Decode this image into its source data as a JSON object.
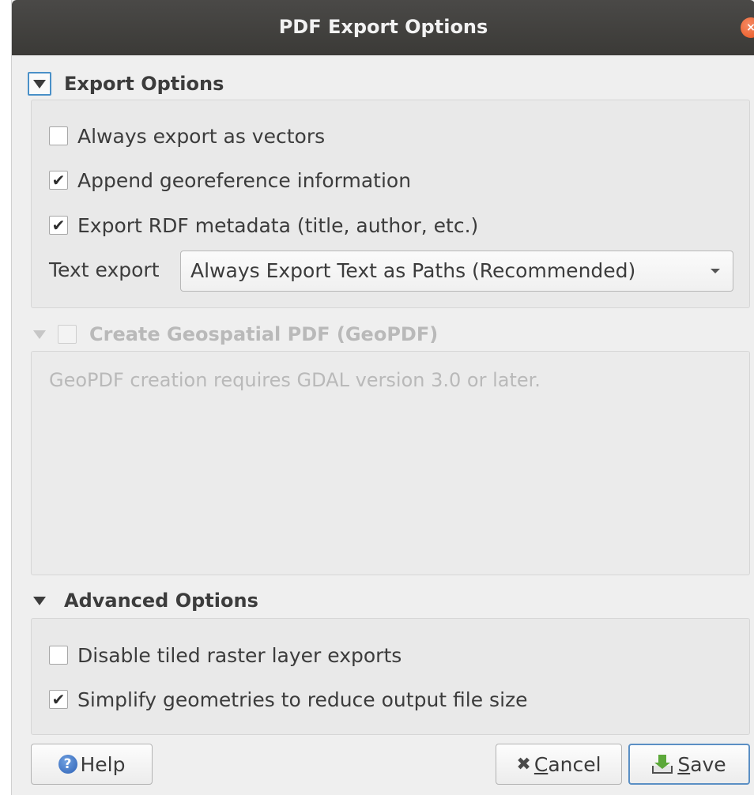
{
  "dialog": {
    "title": "PDF Export Options",
    "close_glyph": "×"
  },
  "export_options": {
    "header": "Export Options",
    "always_vectors": {
      "label": "Always export as vectors",
      "checked": false
    },
    "append_georef": {
      "label": "Append georeference information",
      "checked": true
    },
    "export_rdf": {
      "label": "Export RDF metadata (title, author, etc.)",
      "checked": true
    },
    "text_export_label": "Text export",
    "text_export_value": "Always Export Text as Paths (Recommended)"
  },
  "geopdf": {
    "header": "Create Geospatial PDF (GeoPDF)",
    "checked": false,
    "enabled": false,
    "message": "GeoPDF creation requires GDAL version 3.0 or later."
  },
  "advanced_options": {
    "header": "Advanced Options",
    "disable_tiled": {
      "label": "Disable tiled raster layer exports",
      "checked": false
    },
    "simplify": {
      "label": "Simplify geometries to reduce output file size",
      "checked": true
    }
  },
  "buttons": {
    "help": {
      "icon_glyph": "?",
      "label": "Help"
    },
    "cancel": {
      "icon_glyph": "✖",
      "mnemonic": "C",
      "label_rest": "ancel"
    },
    "save": {
      "mnemonic": "S",
      "label_rest": "ave"
    }
  },
  "check_glyph": "✔",
  "icons": {
    "close": "close-icon",
    "help": "help-icon",
    "cancel": "cancel-icon",
    "save": "save-icon",
    "expand": "chevron-down-icon"
  },
  "colors": {
    "titlebar": "#3b3a37",
    "close": "#e8551f",
    "focus": "#4a90c8",
    "disabled_text": "#b9b9b9"
  }
}
